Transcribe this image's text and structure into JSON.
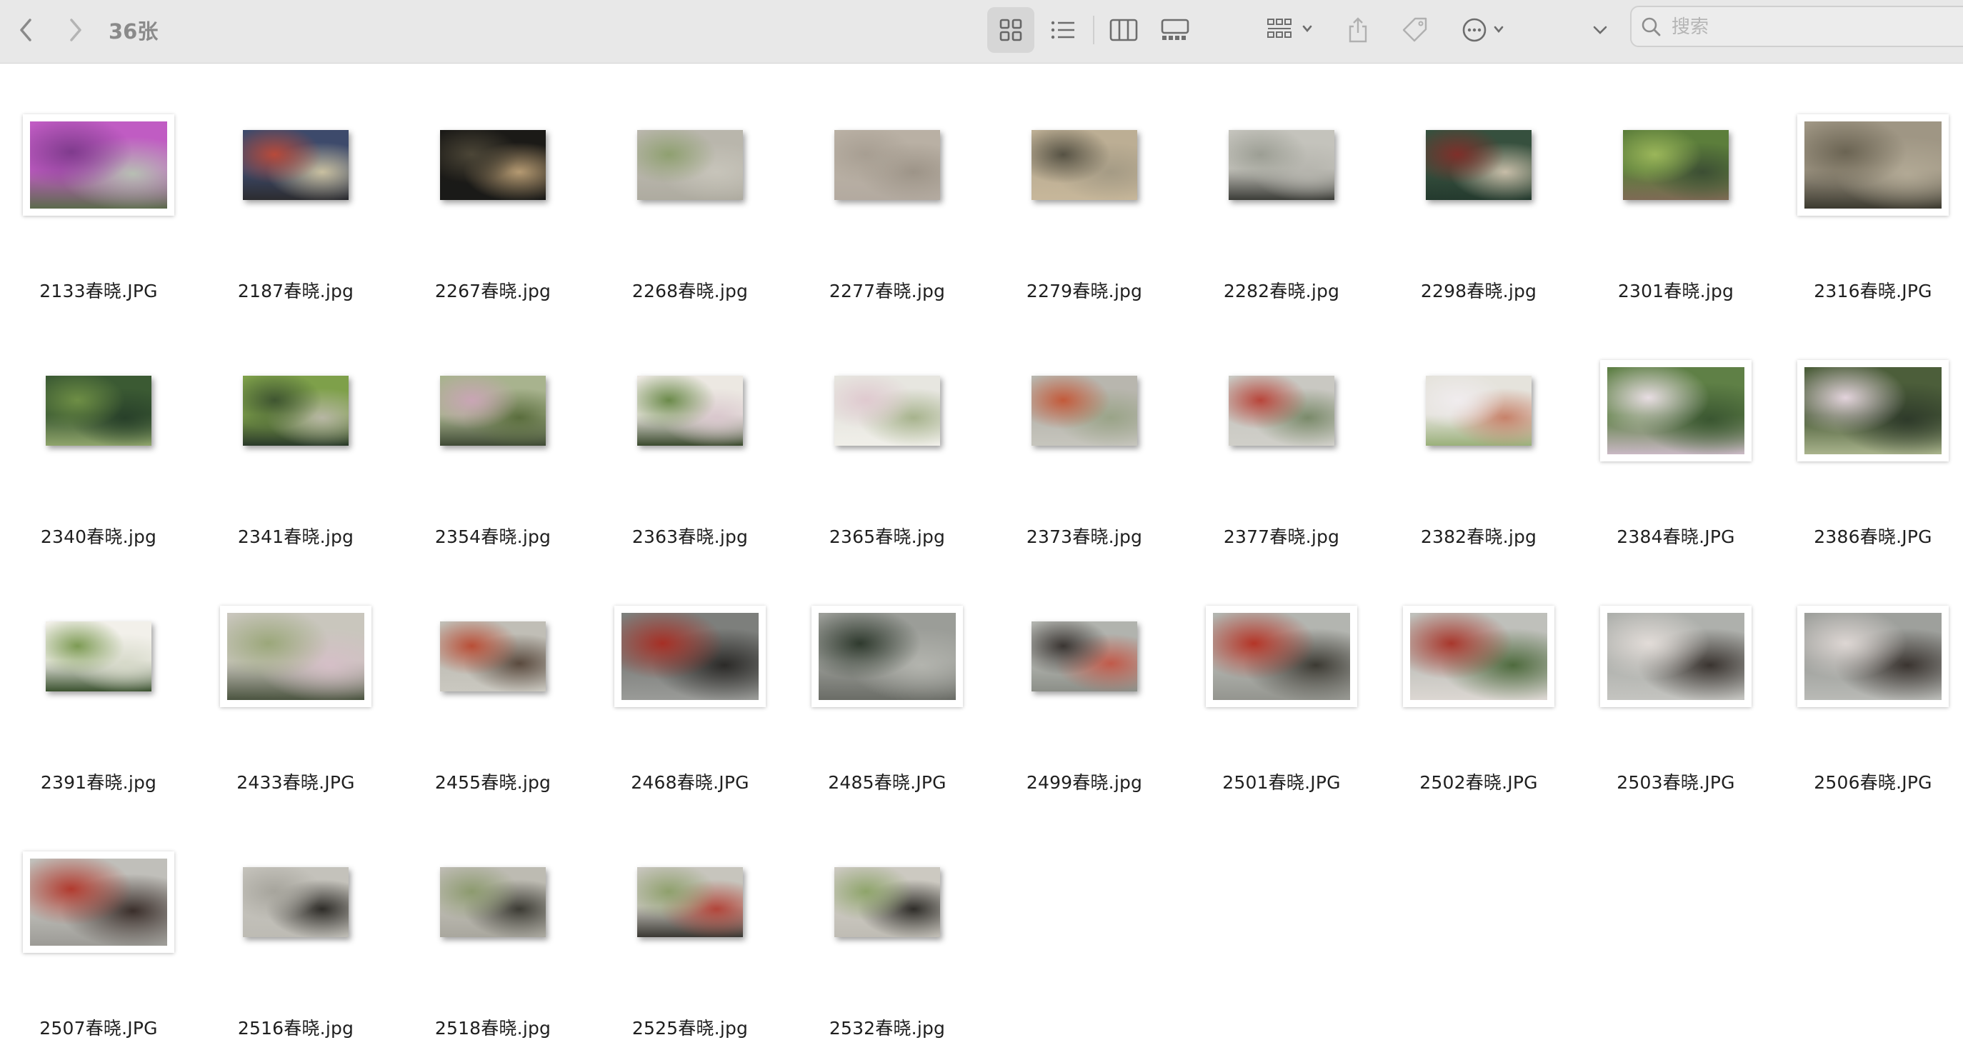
{
  "toolbar": {
    "title": "36张",
    "search_placeholder": "搜索",
    "icons": [
      "chevron-left-icon",
      "chevron-right-icon",
      "grid-view-icon",
      "list-view-icon",
      "column-view-icon",
      "gallery-view-icon",
      "group-icon",
      "share-icon",
      "tag-icon",
      "more-icon",
      "chevron-down-icon",
      "search-icon"
    ],
    "selected_view": "grid-view"
  },
  "files": [
    {
      "name": "2133春晓.JPG",
      "orientation": "landscape",
      "framed": true,
      "colors": [
        "#c05cc3",
        "#7f3b8d",
        "#b7bfb3",
        "#5c6b4c"
      ]
    },
    {
      "name": "2187春晓.jpg",
      "orientation": "landscape",
      "framed": false,
      "colors": [
        "#3d4a6b",
        "#b84a3a",
        "#c9c0a0",
        "#2c2c30"
      ]
    },
    {
      "name": "2267春晓.jpg",
      "orientation": "landscape",
      "framed": false,
      "colors": [
        "#1b1a17",
        "#4c4637",
        "#b59a72",
        "#1a1a18"
      ]
    },
    {
      "name": "2268春晓.jpg",
      "orientation": "landscape",
      "framed": false,
      "colors": [
        "#b9b6ac",
        "#8fa070",
        "#c7c4ba",
        "#aeaba0"
      ]
    },
    {
      "name": "2277春晓.jpg",
      "orientation": "landscape",
      "framed": false,
      "colors": [
        "#b9b0a4",
        "#a79e92",
        "#9d9488",
        "#b3aaa0"
      ]
    },
    {
      "name": "2279春晓.jpg",
      "orientation": "landscape",
      "framed": false,
      "colors": [
        "#bcae94",
        "#565244",
        "#a59b85",
        "#c7b79a"
      ]
    },
    {
      "name": "2282春晓.jpg",
      "orientation": "landscape",
      "framed": false,
      "colors": [
        "#c4c3bc",
        "#9c9e94",
        "#b5b4ad",
        "#3b3c37"
      ]
    },
    {
      "name": "2298春晓.jpg",
      "orientation": "landscape",
      "framed": false,
      "colors": [
        "#36503e",
        "#7f2f2a",
        "#c7bda8",
        "#243a2e"
      ]
    },
    {
      "name": "2301春晓.jpg",
      "orientation": "landscape",
      "framed": false,
      "colors": [
        "#5c7e3b",
        "#9bb65a",
        "#3c4e34",
        "#7e6a55"
      ]
    },
    {
      "name": "2316春晓.JPG",
      "orientation": "landscape",
      "framed": true,
      "colors": [
        "#9f9684",
        "#6b6453",
        "#b2a995",
        "#3c3a30"
      ]
    },
    {
      "name": "2340春晓.jpg",
      "orientation": "landscape",
      "framed": false,
      "colors": [
        "#3b5a33",
        "#6e8e45",
        "#28402a",
        "#8fa46b"
      ]
    },
    {
      "name": "2341春晓.jpg",
      "orientation": "landscape",
      "framed": false,
      "colors": [
        "#7ea04a",
        "#3f5531",
        "#b7b6a4",
        "#2a3a2a"
      ]
    },
    {
      "name": "2354春晓.jpg",
      "orientation": "landscape",
      "framed": false,
      "colors": [
        "#a8b38e",
        "#c9a5b5",
        "#5a6d3d",
        "#3f4a35"
      ]
    },
    {
      "name": "2363春晓.jpg",
      "orientation": "landscape",
      "framed": false,
      "colors": [
        "#ece8e2",
        "#6b8a4a",
        "#d9c7cd",
        "#3b4a2e"
      ]
    },
    {
      "name": "2365春晓.jpg",
      "orientation": "landscape",
      "framed": false,
      "colors": [
        "#e7e6e0",
        "#dfc9cf",
        "#a7b38d",
        "#f0efe9"
      ]
    },
    {
      "name": "2373春晓.jpg",
      "orientation": "landscape",
      "framed": false,
      "colors": [
        "#b8b6ae",
        "#c35a3a",
        "#9aa488",
        "#c6c5bd"
      ]
    },
    {
      "name": "2377春晓.jpg",
      "orientation": "landscape",
      "framed": false,
      "colors": [
        "#c9c8c2",
        "#b8453a",
        "#7a8a6a",
        "#d0cfc9"
      ]
    },
    {
      "name": "2382春晓.jpg",
      "orientation": "landscape",
      "framed": false,
      "colors": [
        "#e5e3dc",
        "#f0ecee",
        "#c7826a",
        "#9ab07a"
      ]
    },
    {
      "name": "2384春晓.JPG",
      "orientation": "landscape",
      "framed": true,
      "colors": [
        "#5f8046",
        "#e8dde3",
        "#3a5631",
        "#c9b8c4"
      ]
    },
    {
      "name": "2386春晓.JPG",
      "orientation": "landscape",
      "framed": true,
      "colors": [
        "#4c5e3a",
        "#e3d3dc",
        "#2e3a2a",
        "#a9b38c"
      ]
    },
    {
      "name": "2391春晓.jpg",
      "orientation": "landscape",
      "framed": false,
      "colors": [
        "#f2f0ea",
        "#7d9b54",
        "#d6d9c9",
        "#3b5230"
      ]
    },
    {
      "name": "2433春晓.JPG",
      "orientation": "landscape",
      "framed": true,
      "colors": [
        "#c9c6bd",
        "#9ba77a",
        "#d5bfc7",
        "#4b5440"
      ]
    },
    {
      "name": "2455春晓.jpg",
      "orientation": "landscape",
      "framed": false,
      "colors": [
        "#c0beb6",
        "#b94e36",
        "#5a4a3e",
        "#cac8c0"
      ]
    },
    {
      "name": "2468春晓.JPG",
      "orientation": "landscape",
      "framed": true,
      "colors": [
        "#7d7f7c",
        "#a62f25",
        "#2b2a28",
        "#9a9b98"
      ]
    },
    {
      "name": "2485春晓.JPG",
      "orientation": "landscape",
      "framed": true,
      "colors": [
        "#9b9d98",
        "#2f3a2e",
        "#b3b4ae",
        "#6a6c66"
      ]
    },
    {
      "name": "2499春晓.jpg",
      "orientation": "landscape",
      "framed": false,
      "colors": [
        "#b1b3ae",
        "#3a3532",
        "#c15a4a",
        "#8c8f88"
      ]
    },
    {
      "name": "2501春晓.JPG",
      "orientation": "landscape",
      "framed": true,
      "colors": [
        "#b3b5b0",
        "#b43527",
        "#3c3a33",
        "#94958f"
      ]
    },
    {
      "name": "2502春晓.JPG",
      "orientation": "landscape",
      "framed": true,
      "colors": [
        "#bfc0bb",
        "#a8372c",
        "#4f6b3e",
        "#dcd7d2"
      ]
    },
    {
      "name": "2503春晓.JPG",
      "orientation": "landscape",
      "framed": true,
      "colors": [
        "#aeb0ac",
        "#e2dcd8",
        "#3a3430",
        "#c4c4c0"
      ]
    },
    {
      "name": "2506春晓.JPG",
      "orientation": "landscape",
      "framed": true,
      "colors": [
        "#9ea09c",
        "#ddd6d3",
        "#3a3430",
        "#b9bab6"
      ]
    },
    {
      "name": "2507春晓.JPG",
      "orientation": "landscape",
      "framed": true,
      "colors": [
        "#c0bfba",
        "#b13a2e",
        "#3a2e2a",
        "#9c9b96"
      ]
    },
    {
      "name": "2516春晓.jpg",
      "orientation": "landscape",
      "framed": false,
      "colors": [
        "#c4c2bb",
        "#a6a49c",
        "#2e2c28",
        "#bdbbb4"
      ]
    },
    {
      "name": "2518春晓.jpg",
      "orientation": "landscape",
      "framed": false,
      "colors": [
        "#bdbbb2",
        "#8c9a6e",
        "#3c3b34",
        "#a9a79e"
      ]
    },
    {
      "name": "2525春晓.jpg",
      "orientation": "landscape",
      "framed": false,
      "colors": [
        "#c7c5bd",
        "#8fa06c",
        "#b2453a",
        "#3a3833"
      ]
    },
    {
      "name": "2532春晓.jpg",
      "orientation": "landscape",
      "framed": false,
      "colors": [
        "#ccc9c1",
        "#8ea46a",
        "#2f2d29",
        "#bfbcb4"
      ]
    }
  ]
}
